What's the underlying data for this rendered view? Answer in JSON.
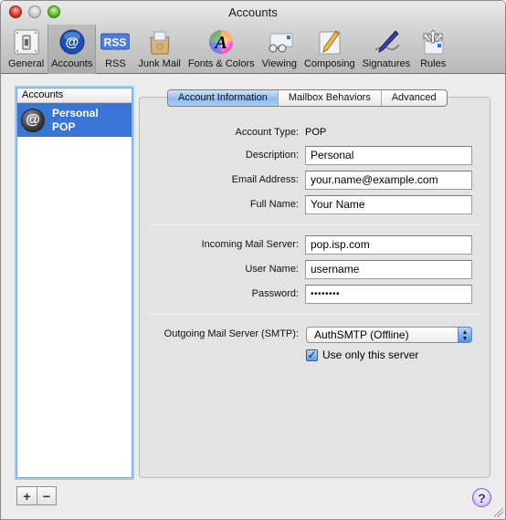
{
  "window": {
    "title": "Accounts"
  },
  "toolbar": {
    "items": [
      {
        "label": "General",
        "icon": "switch-icon"
      },
      {
        "label": "Accounts",
        "icon": "at-sign-icon",
        "selected": true
      },
      {
        "label": "RSS",
        "icon": "rss-icon"
      },
      {
        "label": "Junk Mail",
        "icon": "junk-mail-icon"
      },
      {
        "label": "Fonts & Colors",
        "icon": "fonts-colors-icon"
      },
      {
        "label": "Viewing",
        "icon": "glasses-icon"
      },
      {
        "label": "Composing",
        "icon": "pencil-icon"
      },
      {
        "label": "Signatures",
        "icon": "pen-icon"
      },
      {
        "label": "Rules",
        "icon": "rules-arrows-icon"
      }
    ]
  },
  "sidebar": {
    "header": "Accounts",
    "accounts": [
      {
        "name": "Personal",
        "type": "POP",
        "selected": true
      }
    ],
    "add_label": "+",
    "remove_label": "−"
  },
  "tabs": [
    {
      "label": "Account Information",
      "active": true
    },
    {
      "label": "Mailbox Behaviors",
      "active": false
    },
    {
      "label": "Advanced",
      "active": false
    }
  ],
  "form": {
    "account_type_label": "Account Type:",
    "account_type_value": "POP",
    "description_label": "Description:",
    "description_value": "Personal",
    "email_label": "Email Address:",
    "email_value": "your.name@example.com",
    "full_name_label": "Full Name:",
    "full_name_value": "Your Name",
    "incoming_label": "Incoming Mail Server:",
    "incoming_value": "pop.isp.com",
    "username_label": "User Name:",
    "username_value": "username",
    "password_label": "Password:",
    "password_value": "••••••••",
    "smtp_label": "Outgoing Mail Server (SMTP):",
    "smtp_value": "AuthSMTP (Offline)",
    "use_only_label": "Use only this server",
    "use_only_checked": true
  },
  "help": {
    "label": "?"
  },
  "colors": {
    "selection_blue": "#3875d7",
    "tab_active": "#8ebbf0"
  }
}
